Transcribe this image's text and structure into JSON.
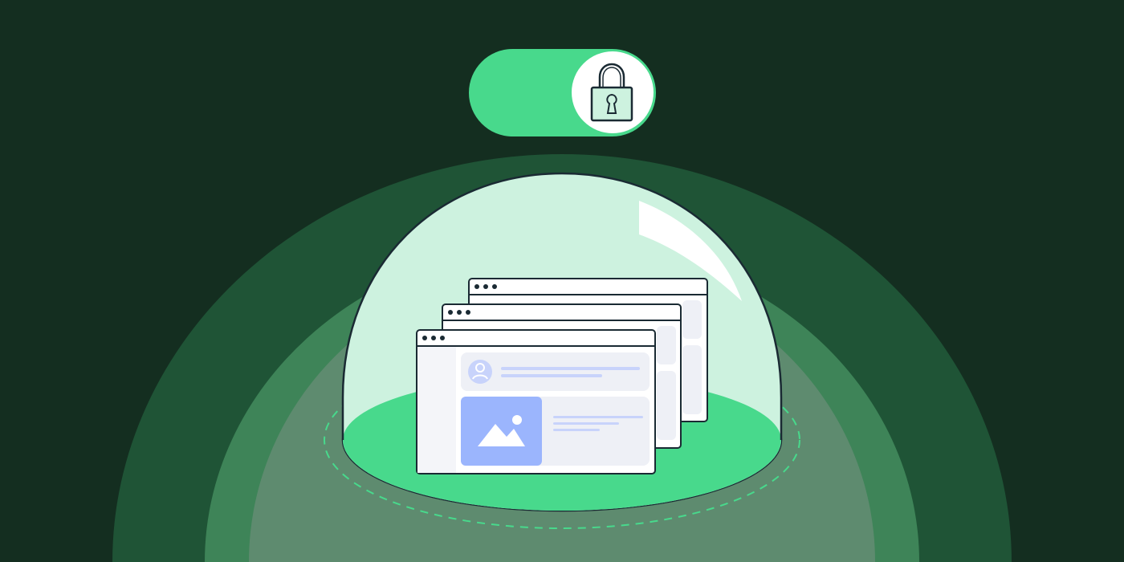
{
  "scene": {
    "description_tag": "privacy-illustration",
    "colors": {
      "background": "#142e20",
      "arc_outer": "#1f5436",
      "arc_middle": "#3e8458",
      "arc_inner": "#5e8b6f",
      "dome_glass": "#cdf2df",
      "dome_outline": "#1a2a33",
      "platform": "#48d98c",
      "dashed_ring": "#48d98c",
      "toggle_track": "#48d98c",
      "toggle_knob": "#ffffff",
      "lock_body": "#cdf2df",
      "lock_stroke": "#1a2a33",
      "window_bg": "#ffffff",
      "window_panel": "#f4f5f9",
      "window_card": "#eef0f6",
      "avatar_bg": "#c8d3fb",
      "image_tile": "#9bb5fd",
      "text_line": "#c8d3fb"
    },
    "toggle": {
      "state": "on",
      "icon": "lock-icon"
    },
    "dome": {
      "icon": "glass-dome-icon",
      "highlight": "white-reflection"
    },
    "windows": {
      "count": 3,
      "icons": [
        "browser-window-icon",
        "user-avatar-icon",
        "image-placeholder-icon"
      ]
    }
  }
}
